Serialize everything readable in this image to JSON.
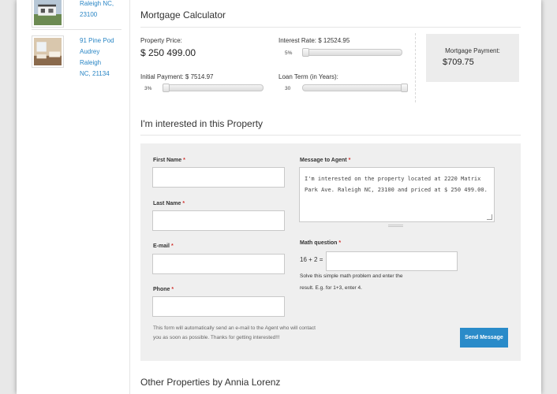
{
  "sidebar": {
    "items": [
      {
        "lines": [
          "Raleigh NC,",
          "23100"
        ]
      },
      {
        "lines": [
          "91 Pine Pod",
          "Audrey Raleigh",
          "NC, 21134"
        ]
      }
    ]
  },
  "calculator": {
    "title": "Mortgage Calculator",
    "property_price_label": "Property Price:",
    "property_price_value": "$ 250 499.00",
    "interest_rate_label": "Interest Rate:  $ 12524.95",
    "interest_rate_pct": "5%",
    "initial_payment_label": "Initial Payment:  $ 7514.97",
    "initial_payment_pct": "3%",
    "loan_term_label": "Loan Term (in Years):",
    "loan_term_value": "30",
    "payment_label": "Mortgage Payment:",
    "payment_value": "$709.75"
  },
  "inquiry": {
    "title": "I'm interested in this Property",
    "first_name_label": "First Name",
    "last_name_label": "Last Name",
    "email_label": "E-mail",
    "phone_label": "Phone",
    "required_mark": "*",
    "message_label": "Message to Agent",
    "message_value": "I'm interested on the property located at 2220 Matrix Park Ave. Raleigh NC, 23100 and priced at $ 250 499.00.",
    "math_label": "Math question",
    "math_question": "16 + 2 =",
    "math_help_1": "Solve this simple math problem and enter the",
    "math_help_2": "result. E.g. for 1+3, enter 4.",
    "note_1": "This form will automatically send an e-mail to the Agent who will contact",
    "note_2": "you as soon as possible. Thanks for getting interested!!!",
    "send_label": "Send Message"
  },
  "other": {
    "title": "Other Properties by Annia Lorenz"
  }
}
